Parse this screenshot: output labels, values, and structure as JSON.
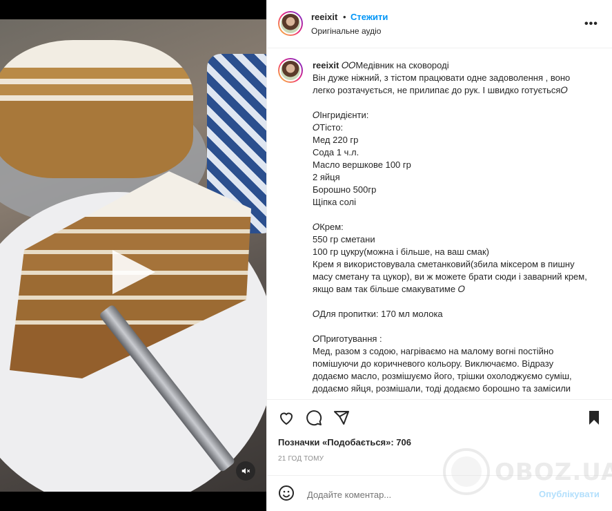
{
  "post": {
    "username": "reeixit",
    "separator": "•",
    "follow_label": "Стежити",
    "audio_label": "Оригінальне аудіо",
    "more_label": "•••"
  },
  "caption": {
    "username": "reeixit",
    "text": "𝑂𝑂Медівник на сковороді\nВін дуже ніжний, з тістом працювати одне задоволення , воно легко розтачується, не прилипає до рук. І швидко готується𝑂\n\n𝑂Інгридієнти:\n𝑂Тісто:\nМед 220 гр\nСода 1 ч.л.\nМасло вершкове 100 гр\n2 яйця\nБорошно 500гр\nЩіпка солі\n\n𝑂Крем:\n550 гр сметани\n100 гр цукру(можна і більше, на ваш смак)\nКрем я використовувала сметанковий(збила міксером в пишну масу сметану та цукор), ви ж можете брати сюди і заварний крем, якщо вам так більше смакуватиме 𝑂\n\n𝑂Для пропитки: 170 мл молока\n\n𝑂Приготування :\nМед, разом з содою, нагріваємо на малому вогні постійно помішуючи до коричневого кольору. Виключаємо. Відразу додаємо масло, розмішуємо його, трішки охолоджуємо суміш, додаємо яйця, розмішали, тоді додаємо борошно та замісили"
  },
  "stats": {
    "likes_text": "Позначки «Подобається»: 706",
    "time_text": "21 ГОД ТОМУ"
  },
  "comment": {
    "placeholder": "Додайте коментар...",
    "publish_label": "Опублікувати"
  },
  "watermark": {
    "text": "OBOZ.UA"
  },
  "colors": {
    "accent": "#0095f6",
    "publish_disabled": "#b2dffc",
    "muted": "#8e8e8e",
    "border": "#efefef"
  }
}
